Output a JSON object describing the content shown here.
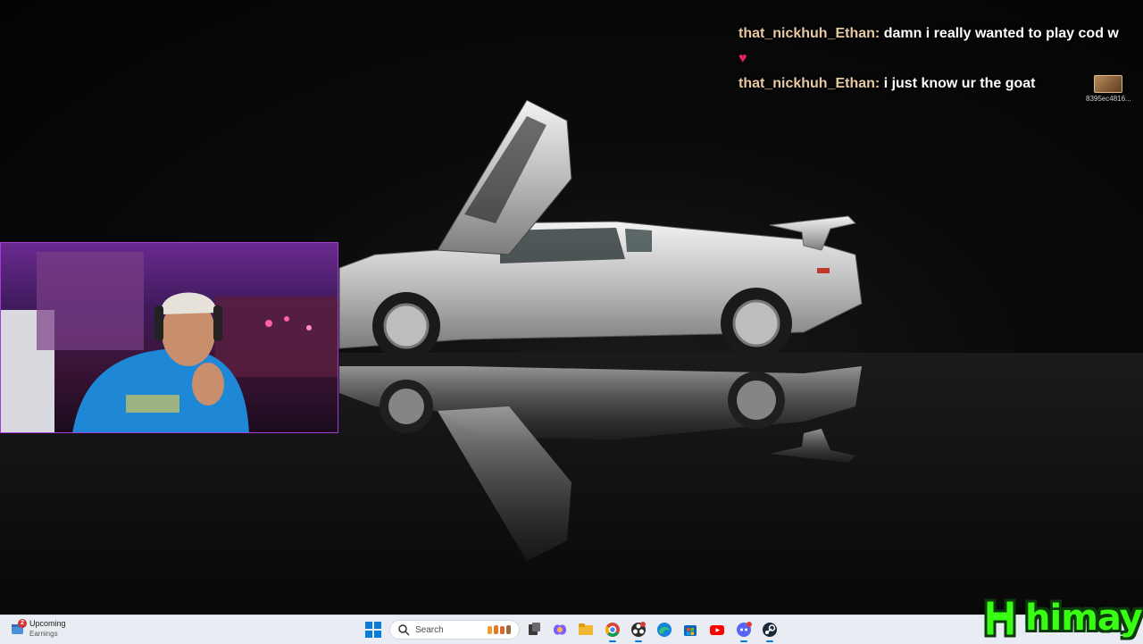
{
  "chat": {
    "messages": [
      {
        "user": "that_nickhuh_Ethan:",
        "text": "damn i really wanted to play cod w"
      },
      {
        "user": "that_nickhuh_Ethan:",
        "text": "i just know ur the goat"
      }
    ],
    "heart_emote": "♥",
    "viewer_id": "8395ec4816..."
  },
  "taskbar": {
    "widget": {
      "badge": "2",
      "title": "Upcoming",
      "subtitle": "Earnings"
    },
    "search_placeholder": "Search",
    "pinned": [
      {
        "name": "task-view-icon",
        "color": "#3a3a3a"
      },
      {
        "name": "copilot-icon",
        "color": "#7a5cff"
      },
      {
        "name": "file-explorer-icon",
        "color": "#f2b632"
      },
      {
        "name": "chrome-icon",
        "color": "#db4437"
      },
      {
        "name": "obs-icon",
        "color": "#2b2b2b"
      },
      {
        "name": "edge-icon",
        "color": "#1583d8"
      },
      {
        "name": "microsoft-store-icon",
        "color": "#0a64c4"
      },
      {
        "name": "youtube-icon",
        "color": "#ff0000"
      },
      {
        "name": "discord-icon",
        "color": "#5865f2"
      },
      {
        "name": "steam-icon",
        "color": "#1b2838"
      }
    ]
  },
  "brand": {
    "name": "himay",
    "accent": "#39ff14"
  }
}
